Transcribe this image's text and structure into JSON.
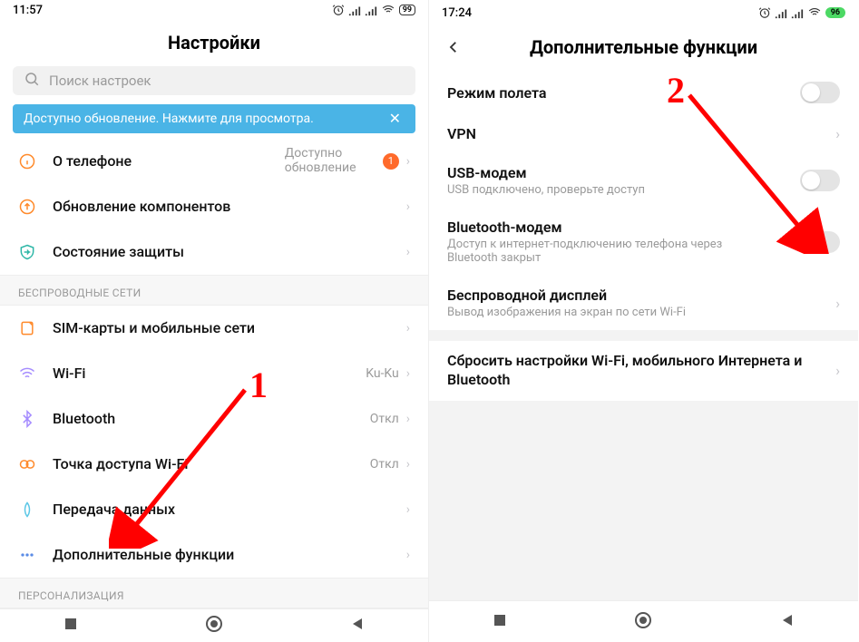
{
  "left": {
    "status": {
      "time": "11:57",
      "battery": "99"
    },
    "title": "Настройки",
    "search_placeholder": "Поиск настроек",
    "banner": {
      "text": "Доступно обновление. Нажмите для просмотра.",
      "close": "✕"
    },
    "items": {
      "about": {
        "label": "О телефоне",
        "sub": "Доступно обновление",
        "badge": "1"
      },
      "update": {
        "label": "Обновление компонентов"
      },
      "security": {
        "label": "Состояние защиты"
      }
    },
    "section_wireless": "БЕСПРОВОДНЫЕ СЕТИ",
    "wireless": {
      "sim": {
        "label": "SIM-карты и мобильные сети"
      },
      "wifi": {
        "label": "Wi-Fi",
        "sub": "Ku-Ku"
      },
      "bluetooth": {
        "label": "Bluetooth",
        "sub": "Откл"
      },
      "hotspot": {
        "label": "Точка доступа Wi-Fi",
        "sub": "Откл"
      },
      "data": {
        "label": "Передача данных"
      },
      "more": {
        "label": "Дополнительные функции"
      }
    },
    "section_personal": "ПЕРСОНАЛИЗАЦИЯ"
  },
  "right": {
    "status": {
      "time": "17:24",
      "battery": "96"
    },
    "title": "Дополнительные функции",
    "items": {
      "airplane": {
        "title": "Режим полета"
      },
      "vpn": {
        "title": "VPN"
      },
      "usb": {
        "title": "USB-модем",
        "desc": "USB подключено, проверьте доступ"
      },
      "btmodem": {
        "title": "Bluetooth-модем",
        "desc": "Доступ к интернет-подключению телефона через Bluetooth закрыт"
      },
      "wdisplay": {
        "title": "Беспроводной дисплей",
        "desc": "Вывод изображения на экран по сети Wi-Fi"
      },
      "reset": {
        "title": "Сбросить настройки Wi-Fi, мобильного Интернета и Bluetooth"
      }
    }
  },
  "annotations": {
    "a1": "1",
    "a2": "2"
  }
}
